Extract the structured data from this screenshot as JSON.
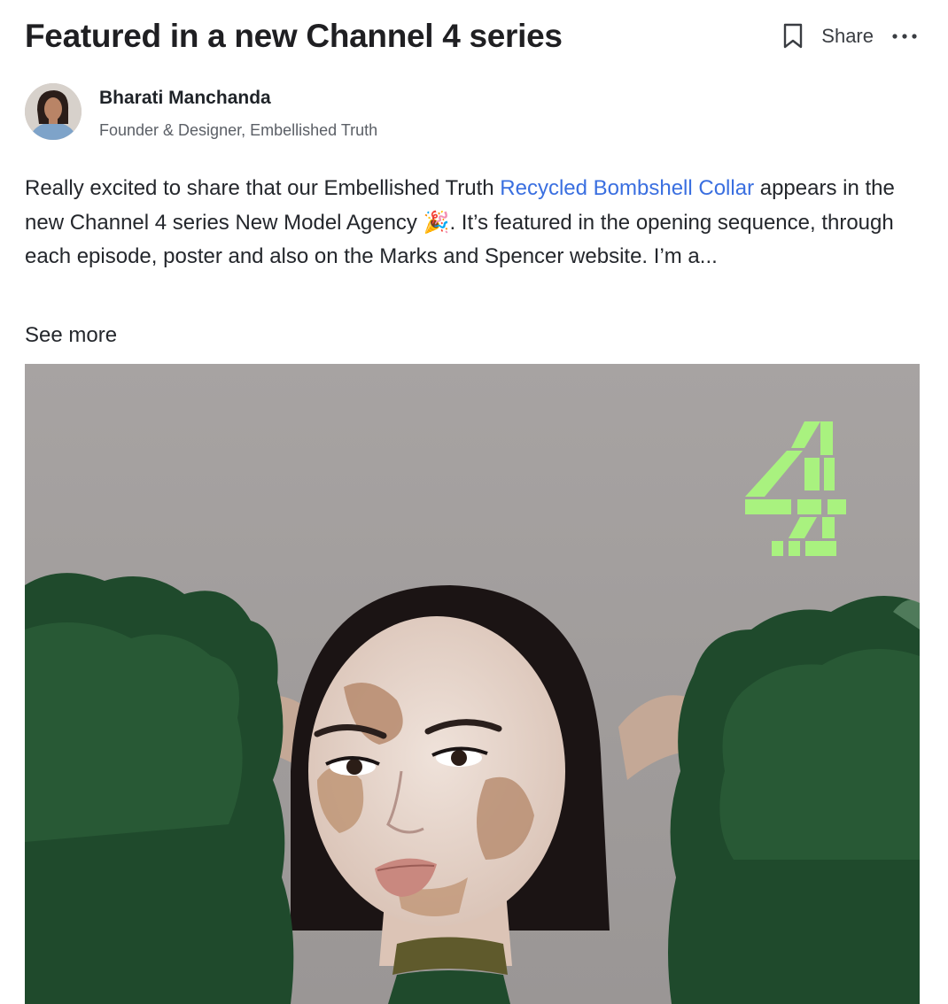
{
  "post": {
    "title": "Featured in a new Channel 4 series",
    "actions": {
      "bookmark_icon": "bookmark-icon",
      "share_label": "Share",
      "more_icon": "more-horizontal-icon"
    },
    "author": {
      "name": "Bharati Manchanda",
      "role": "Founder & Designer, Embellished Truth"
    },
    "body": {
      "text_before_link": "Really excited to share that our Embellished Truth ",
      "link_text": "Recycled Bombshell Collar",
      "text_after_link": " appears in the new Channel 4 series New Model Agency ",
      "emoji": "🎉",
      "text_end": ". It’s featured in the opening sequence, through each episode, poster and also on the Marks and Spencer website. I’m a..."
    },
    "see_more_label": "See more",
    "image": {
      "logo": "channel-4-logo",
      "logo_color": "#a9f27f",
      "fur_color": "#1f4a2c",
      "background_color": "#a6a2a1"
    }
  }
}
